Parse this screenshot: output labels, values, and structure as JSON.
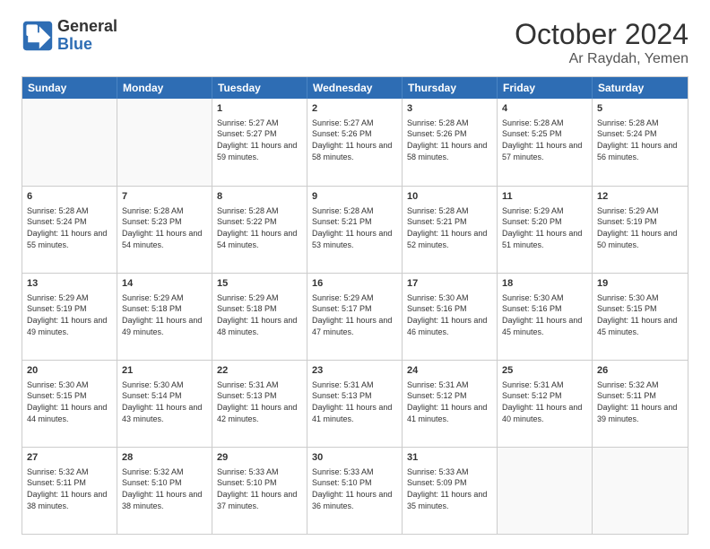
{
  "logo": {
    "text_line1": "General",
    "text_line2": "Blue"
  },
  "header": {
    "month": "October 2024",
    "location": "Ar Raydah, Yemen"
  },
  "days_of_week": [
    "Sunday",
    "Monday",
    "Tuesday",
    "Wednesday",
    "Thursday",
    "Friday",
    "Saturday"
  ],
  "weeks": [
    [
      {
        "day": "",
        "empty": true
      },
      {
        "day": "",
        "empty": true
      },
      {
        "day": "1",
        "sunrise": "5:27 AM",
        "sunset": "5:27 PM",
        "daylight": "11 hours and 59 minutes."
      },
      {
        "day": "2",
        "sunrise": "5:27 AM",
        "sunset": "5:26 PM",
        "daylight": "11 hours and 58 minutes."
      },
      {
        "day": "3",
        "sunrise": "5:28 AM",
        "sunset": "5:26 PM",
        "daylight": "11 hours and 58 minutes."
      },
      {
        "day": "4",
        "sunrise": "5:28 AM",
        "sunset": "5:25 PM",
        "daylight": "11 hours and 57 minutes."
      },
      {
        "day": "5",
        "sunrise": "5:28 AM",
        "sunset": "5:24 PM",
        "daylight": "11 hours and 56 minutes."
      }
    ],
    [
      {
        "day": "6",
        "sunrise": "5:28 AM",
        "sunset": "5:24 PM",
        "daylight": "11 hours and 55 minutes."
      },
      {
        "day": "7",
        "sunrise": "5:28 AM",
        "sunset": "5:23 PM",
        "daylight": "11 hours and 54 minutes."
      },
      {
        "day": "8",
        "sunrise": "5:28 AM",
        "sunset": "5:22 PM",
        "daylight": "11 hours and 54 minutes."
      },
      {
        "day": "9",
        "sunrise": "5:28 AM",
        "sunset": "5:21 PM",
        "daylight": "11 hours and 53 minutes."
      },
      {
        "day": "10",
        "sunrise": "5:28 AM",
        "sunset": "5:21 PM",
        "daylight": "11 hours and 52 minutes."
      },
      {
        "day": "11",
        "sunrise": "5:29 AM",
        "sunset": "5:20 PM",
        "daylight": "11 hours and 51 minutes."
      },
      {
        "day": "12",
        "sunrise": "5:29 AM",
        "sunset": "5:19 PM",
        "daylight": "11 hours and 50 minutes."
      }
    ],
    [
      {
        "day": "13",
        "sunrise": "5:29 AM",
        "sunset": "5:19 PM",
        "daylight": "11 hours and 49 minutes."
      },
      {
        "day": "14",
        "sunrise": "5:29 AM",
        "sunset": "5:18 PM",
        "daylight": "11 hours and 49 minutes."
      },
      {
        "day": "15",
        "sunrise": "5:29 AM",
        "sunset": "5:18 PM",
        "daylight": "11 hours and 48 minutes."
      },
      {
        "day": "16",
        "sunrise": "5:29 AM",
        "sunset": "5:17 PM",
        "daylight": "11 hours and 47 minutes."
      },
      {
        "day": "17",
        "sunrise": "5:30 AM",
        "sunset": "5:16 PM",
        "daylight": "11 hours and 46 minutes."
      },
      {
        "day": "18",
        "sunrise": "5:30 AM",
        "sunset": "5:16 PM",
        "daylight": "11 hours and 45 minutes."
      },
      {
        "day": "19",
        "sunrise": "5:30 AM",
        "sunset": "5:15 PM",
        "daylight": "11 hours and 45 minutes."
      }
    ],
    [
      {
        "day": "20",
        "sunrise": "5:30 AM",
        "sunset": "5:15 PM",
        "daylight": "11 hours and 44 minutes."
      },
      {
        "day": "21",
        "sunrise": "5:30 AM",
        "sunset": "5:14 PM",
        "daylight": "11 hours and 43 minutes."
      },
      {
        "day": "22",
        "sunrise": "5:31 AM",
        "sunset": "5:13 PM",
        "daylight": "11 hours and 42 minutes."
      },
      {
        "day": "23",
        "sunrise": "5:31 AM",
        "sunset": "5:13 PM",
        "daylight": "11 hours and 41 minutes."
      },
      {
        "day": "24",
        "sunrise": "5:31 AM",
        "sunset": "5:12 PM",
        "daylight": "11 hours and 41 minutes."
      },
      {
        "day": "25",
        "sunrise": "5:31 AM",
        "sunset": "5:12 PM",
        "daylight": "11 hours and 40 minutes."
      },
      {
        "day": "26",
        "sunrise": "5:32 AM",
        "sunset": "5:11 PM",
        "daylight": "11 hours and 39 minutes."
      }
    ],
    [
      {
        "day": "27",
        "sunrise": "5:32 AM",
        "sunset": "5:11 PM",
        "daylight": "11 hours and 38 minutes."
      },
      {
        "day": "28",
        "sunrise": "5:32 AM",
        "sunset": "5:10 PM",
        "daylight": "11 hours and 38 minutes."
      },
      {
        "day": "29",
        "sunrise": "5:33 AM",
        "sunset": "5:10 PM",
        "daylight": "11 hours and 37 minutes."
      },
      {
        "day": "30",
        "sunrise": "5:33 AM",
        "sunset": "5:10 PM",
        "daylight": "11 hours and 36 minutes."
      },
      {
        "day": "31",
        "sunrise": "5:33 AM",
        "sunset": "5:09 PM",
        "daylight": "11 hours and 35 minutes."
      },
      {
        "day": "",
        "empty": true
      },
      {
        "day": "",
        "empty": true
      }
    ]
  ]
}
